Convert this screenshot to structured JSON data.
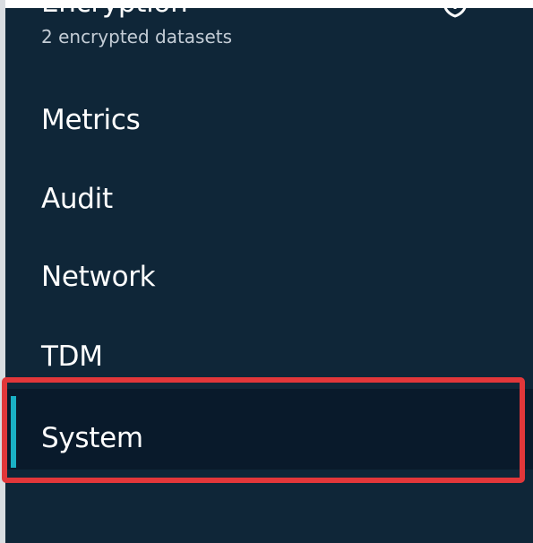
{
  "sidebar": {
    "background_color": "#0f2638",
    "accent_color": "#1ab0c4",
    "highlight_color": "#e2373a",
    "items": [
      {
        "label": "Encryption",
        "sublabel": "2 encrypted datasets",
        "icon": "shield-icon"
      },
      {
        "label": "Metrics"
      },
      {
        "label": "Audit"
      },
      {
        "label": "Network"
      },
      {
        "label": "TDM"
      },
      {
        "label": "System",
        "selected": true
      }
    ]
  }
}
